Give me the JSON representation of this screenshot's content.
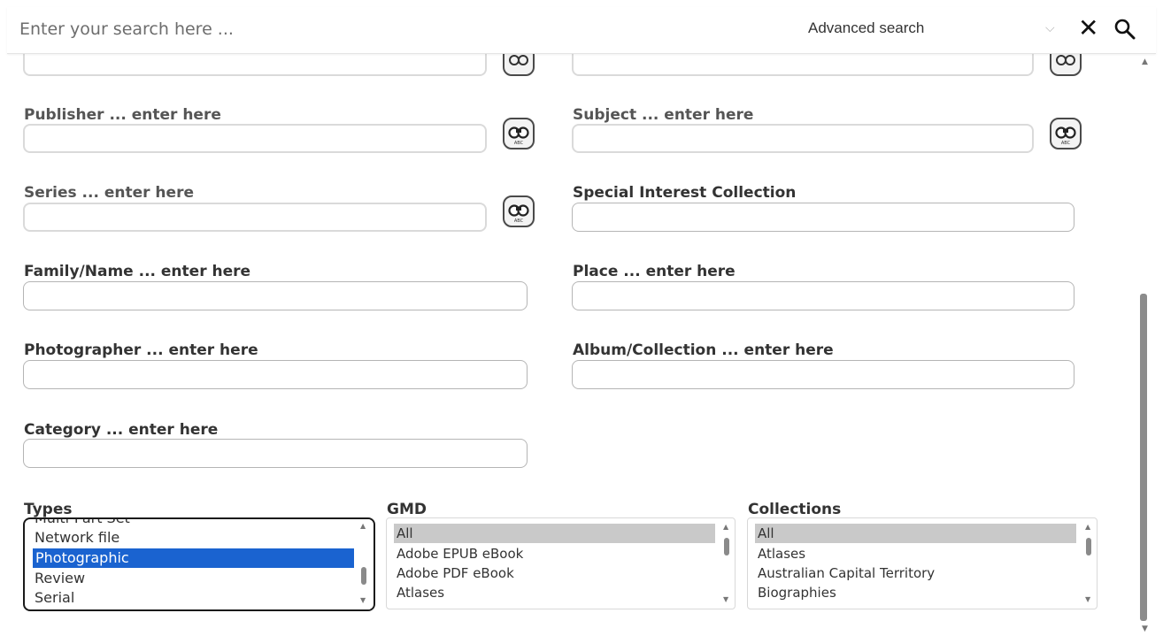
{
  "search": {
    "placeholder": "Enter your search here ...",
    "advanced_label": "Advanced search",
    "chevron": "⌵",
    "close": "✕"
  },
  "fields": {
    "publisher": "Publisher ... enter here",
    "subject": "Subject ... enter here",
    "series": "Series ... enter here",
    "special_interest": "Special Interest Collection",
    "family_name": "Family/Name ... enter here",
    "place": "Place ... enter here",
    "photographer": "Photographer ... enter here",
    "album": "Album/Collection ... enter here",
    "category": "Category ... enter here"
  },
  "types": {
    "label": "Types",
    "options": [
      "Multi-Part Set",
      "Network file",
      "Photographic",
      "Review",
      "Serial"
    ],
    "selected": "Photographic"
  },
  "gmd": {
    "label": "GMD",
    "options": [
      "All",
      "Adobe EPUB eBook",
      "Adobe PDF eBook",
      "Atlases"
    ],
    "selected": "All"
  },
  "collections": {
    "label": "Collections",
    "options": [
      "All",
      "Atlases",
      "Australian Capital Territory",
      "Biographies"
    ],
    "selected": "All"
  },
  "colors": {
    "selection_blue": "#1a63d0",
    "selection_gray": "#c9c9c9"
  },
  "icons": [
    "binoculars-search-icon",
    "close-icon",
    "search-icon",
    "chevron-down-icon"
  ]
}
